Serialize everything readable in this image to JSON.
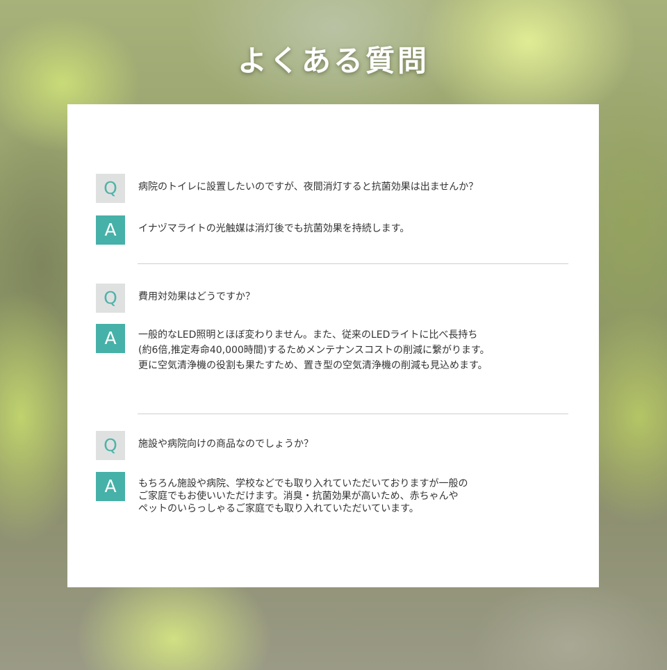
{
  "page": {
    "title": "よくある質問"
  },
  "faq": [
    {
      "q_mark": "Q",
      "a_mark": "A",
      "question": "病院のトイレに設置したいのですが、夜間消灯すると抗菌効果は出ませんか？",
      "answer": "イナヅマライトの光触媒は消灯後でも抗菌効果を持続します。"
    },
    {
      "q_mark": "Q",
      "a_mark": "A",
      "question": "費用対効果はどうですか？",
      "answer": "一般的なLED照明とほぼ変わりません。また、従来のLEDライトに比べ長持ち\n(約6倍,推定寿命40,000時間)するためメンテナンスコストの削減に繋がります。\n更に空気清浄機の役割も果たすため、置き型の空気清浄機の削減も見込めます。"
    },
    {
      "q_mark": "Q",
      "a_mark": "A",
      "question": "施設や病院向けの商品なのでしょうか？",
      "answer": "もちろん施設や病院、学校などでも取り入れていただいておりますが一般の\nご家庭でもお使いいただけます。消臭・抗菌効果が高いため、赤ちゃんや\nペットのいらっしゃるご家庭でも取り入れていただいています。"
    }
  ],
  "colors": {
    "q_badge_bg": "#dfe1e0",
    "q_badge_text": "#4fb3aa",
    "a_badge_bg": "#46b1a8",
    "a_badge_text": "#ffffff"
  }
}
